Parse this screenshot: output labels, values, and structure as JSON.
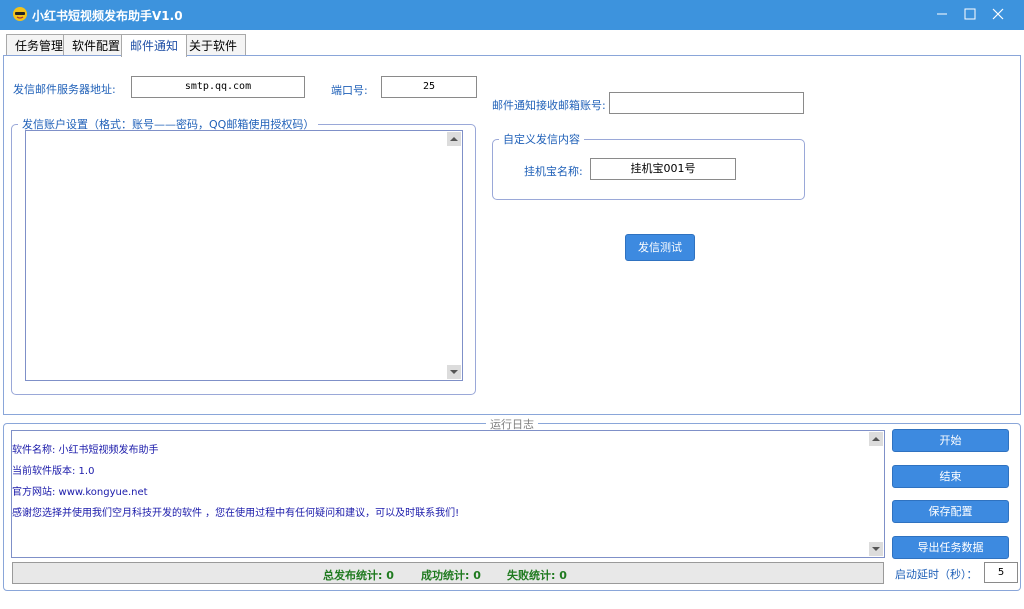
{
  "window": {
    "title": "小红书短视频发布助手V1.0"
  },
  "tabs": [
    "任务管理",
    "软件配置",
    "邮件通知",
    "关于软件"
  ],
  "mail": {
    "smtp_label": "发信邮件服务器地址:",
    "smtp_value": "smtp.qq.com",
    "port_label": "端口号:",
    "port_value": "25",
    "receiver_label": "邮件通知接收邮箱账号:",
    "receiver_value": "",
    "accounts_legend": "发信账户设置（格式：账号——密码，QQ邮箱使用授权码）",
    "custom_legend": "自定义发信内容",
    "machine_label": "挂机宝名称:",
    "machine_value": "挂机宝001号",
    "test_button": "发信测试"
  },
  "log": {
    "legend": "运行日志",
    "lines": [
      "软件名称: 小红书短视频发布助手",
      "当前软件版本: 1.0",
      "官方网站: www.kongyue.net",
      "感谢您选择并使用我们空月科技开发的软件 ，您在使用过程中有任何疑问和建议，可以及时联系我们!"
    ]
  },
  "actions": {
    "start": "开始",
    "stop": "结束",
    "save": "保存配置",
    "export": "导出任务数据",
    "delay_label": "启动延时（秒）：",
    "delay_value": "5"
  },
  "stats": {
    "total": "总发布统计: 0",
    "success": "成功统计: 0",
    "failed": "失败统计: 0"
  },
  "colors": {
    "titlebar": "#3d93dd",
    "button": "#3d8ae0",
    "label": "#1f60b8",
    "log_text": "#1a1aaa",
    "stats_text": "#1f7a1f"
  }
}
